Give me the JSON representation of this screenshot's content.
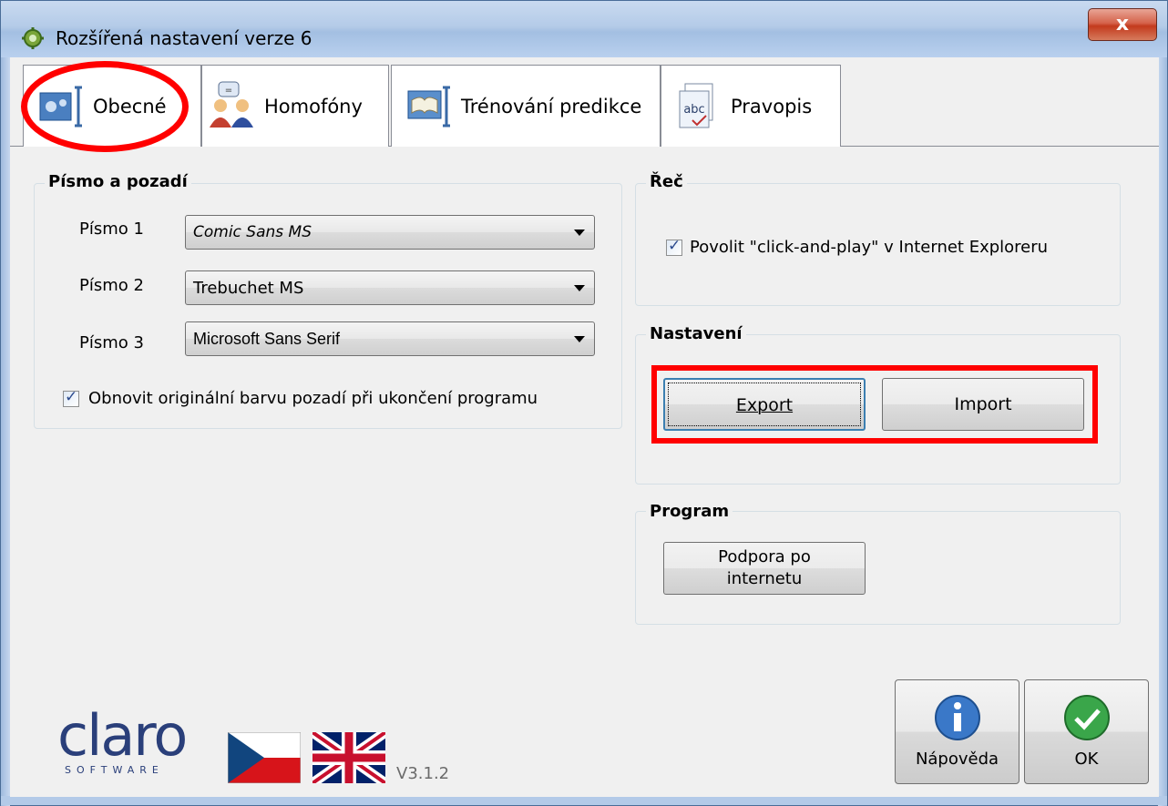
{
  "window": {
    "title": "Rozšířená nastavení verze 6",
    "close_label": "x"
  },
  "tabs": [
    {
      "label": "Obecné",
      "icon": "settings-icon"
    },
    {
      "label": "Homofóny",
      "icon": "people-icon"
    },
    {
      "label": "Trénování predikce",
      "icon": "book-icon"
    },
    {
      "label": "Pravopis",
      "icon": "abc-check-icon"
    }
  ],
  "font_group": {
    "title": "Písmo a pozadí",
    "fonts": [
      {
        "label": "Písmo 1",
        "value": "Comic Sans MS"
      },
      {
        "label": "Písmo 2",
        "value": "Trebuchet MS"
      },
      {
        "label": "Písmo 3",
        "value": "Microsoft Sans Serif"
      }
    ],
    "restore_background_label": "Obnovit originální barvu pozadí při ukončení programu",
    "restore_background_checked": true
  },
  "speech_group": {
    "title": "Řeč",
    "click_and_play_label": "Povolit \"click-and-play\" v Internet Exploreru",
    "click_and_play_checked": true
  },
  "settings_group": {
    "title": "Nastavení",
    "export_label": "Export",
    "import_label": "Import"
  },
  "program_group": {
    "title": "Program",
    "support_label_line1": "Podpora po",
    "support_label_line2": "internetu"
  },
  "footer": {
    "logo_text": "claro",
    "logo_subtext": "SOFTWARE",
    "version": "V3.1.2",
    "help_label": "Nápověda",
    "ok_label": "OK"
  },
  "colors": {
    "highlight": "#ff0000",
    "title_bar": "#b4cbe8",
    "close_button": "#c33a1d"
  }
}
